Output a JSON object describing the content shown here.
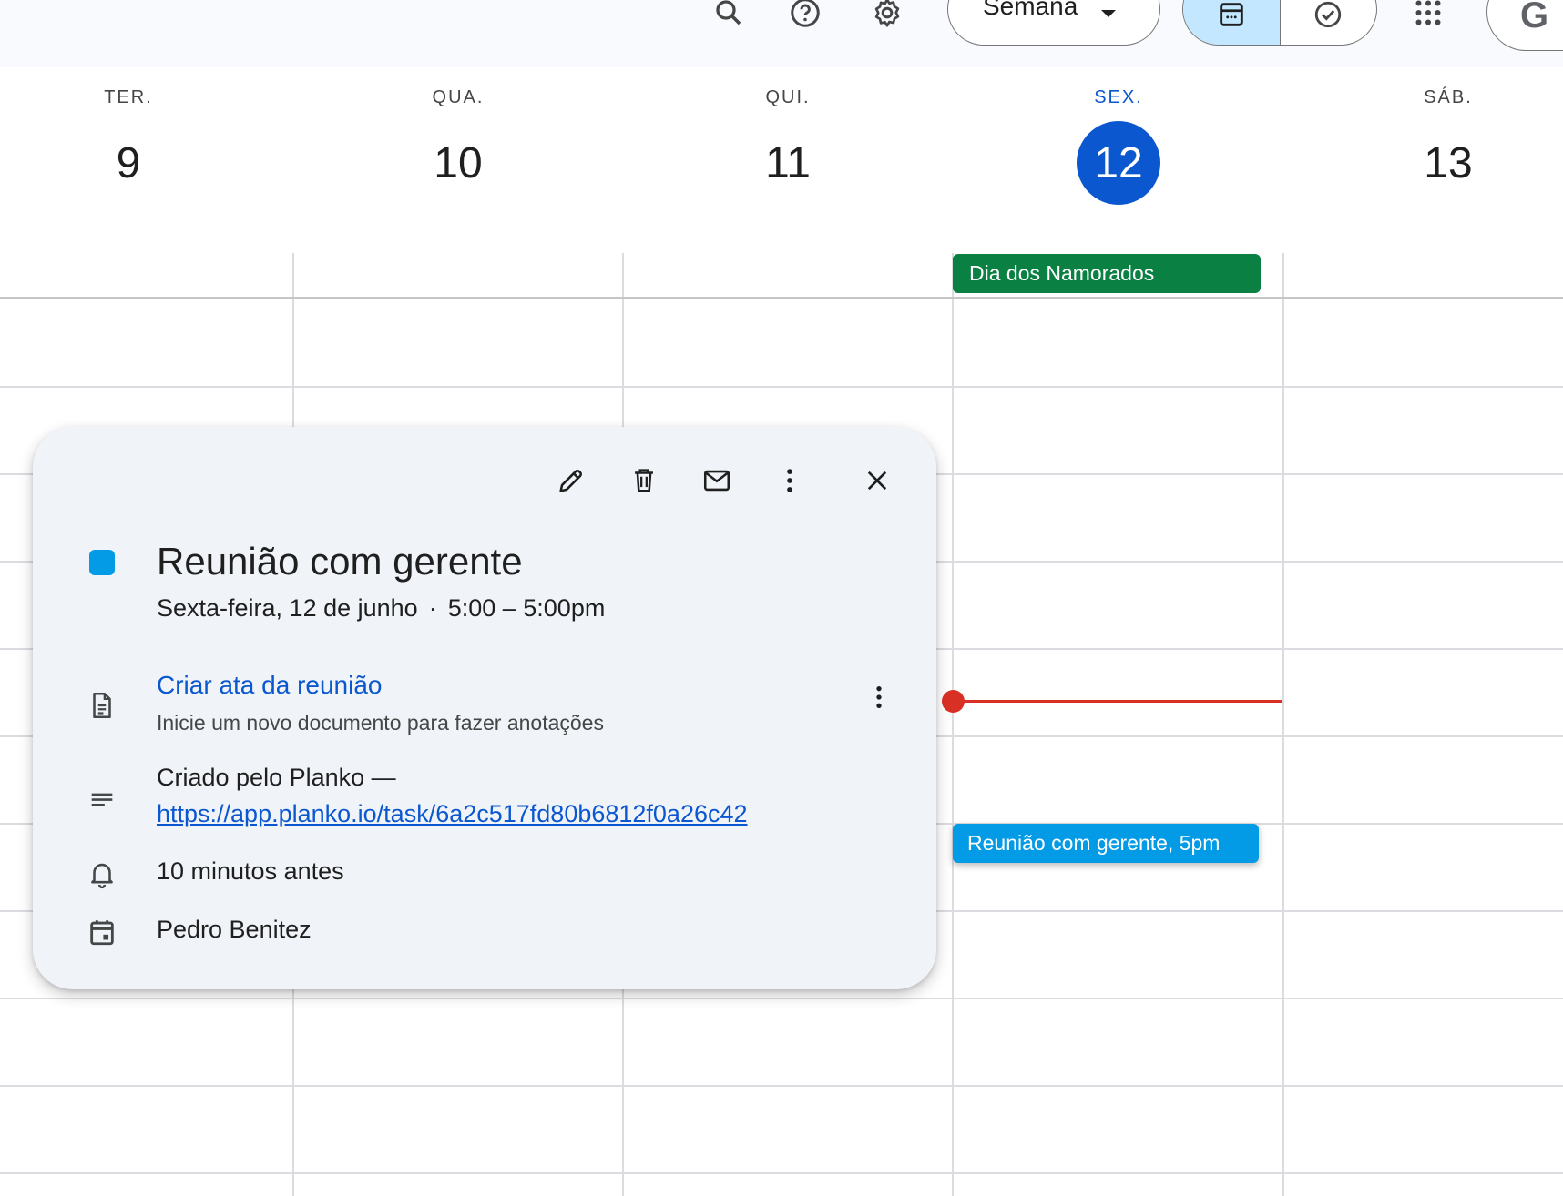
{
  "header": {
    "view_label": "Semana",
    "account_initial": "G"
  },
  "days": [
    {
      "name": "TER.",
      "num": "9"
    },
    {
      "name": "QUA.",
      "num": "10"
    },
    {
      "name": "QUI.",
      "num": "11"
    },
    {
      "name": "SEX.",
      "num": "12"
    },
    {
      "name": "SÁB.",
      "num": "13"
    }
  ],
  "allday_event": {
    "label": "Dia dos Namorados",
    "color": "#0b8043"
  },
  "event_chip": {
    "label": "Reunião com gerente, 5pm",
    "color": "#039be5"
  },
  "popover": {
    "title": "Reunião com gerente",
    "date": "Sexta-feira, 12 de junho",
    "separator": "·",
    "time": "5:00 – 5:00pm",
    "notes_link": "Criar ata da reunião",
    "notes_sub": "Inicie um novo documento para fazer anotações",
    "description": "Criado pelo Planko —",
    "description_link": "https://app.planko.io/task/6a2c517fd80b6812f0a26c42",
    "reminder": "10 minutos antes",
    "calendar_owner": "Pedro Benitez",
    "event_color": "#039be5"
  },
  "colors": {
    "today_accent": "#0b57d0",
    "now_indicator": "#d93025",
    "popover_bg": "#f0f4f9"
  }
}
